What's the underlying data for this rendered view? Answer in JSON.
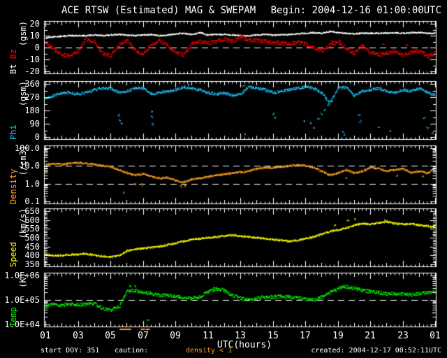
{
  "header": {
    "title": "ACE RTSW (Estimated) MAG & SWEPAM",
    "begin": "Begin: 2004-12-16 01:00:00UTC"
  },
  "footer": {
    "start_doy": "start DOY: 351",
    "caution_label": "caution:",
    "caution_value": "density < 1",
    "created": "created: 2004-12-17 00:52:11UTC"
  },
  "colors": {
    "background": "#000000",
    "frame": "#ffffff",
    "bt": "#ffffff",
    "bz": "#ff0000",
    "phi": "#1fc8ff",
    "density": "#ffa020",
    "speed": "#ffff00",
    "temp": "#00ff00"
  },
  "chart_data": {
    "type": "scatter",
    "title": "ACE RTSW (Estimated) MAG & SWEPAM",
    "x": {
      "label": "UTC(hours)",
      "lim": [
        1,
        25
      ],
      "tick_hours": [
        1,
        3,
        5,
        7,
        9,
        11,
        13,
        15,
        17,
        19,
        21,
        23,
        25
      ],
      "tick_labels": [
        "01",
        "03",
        "05",
        "07",
        "09",
        "11",
        "13",
        "15",
        "17",
        "19",
        "21",
        "23",
        "01"
      ],
      "minor_step_hours": 0.25
    },
    "sample_hours": [
      1,
      1.5,
      2,
      2.5,
      3,
      3.5,
      4,
      4.5,
      5,
      5.5,
      6,
      6.5,
      7,
      7.5,
      8,
      8.5,
      9,
      9.5,
      10,
      10.5,
      11,
      11.5,
      12,
      12.5,
      13,
      13.5,
      14,
      14.5,
      15,
      15.5,
      16,
      16.5,
      17,
      17.5,
      18,
      18.5,
      19,
      19.5,
      20,
      20.5,
      21,
      21.5,
      22,
      22.5,
      23,
      23.5,
      24,
      24.5,
      25
    ],
    "caution_hours": [
      5.7,
      5.95,
      6.15,
      7.0,
      7.3
    ],
    "panels": [
      {
        "id": "mag",
        "ylabel_lines": [
          [
            {
              "text": "Bt ",
              "color": "#ffffff"
            },
            {
              "text": "Bz",
              "color": "#ff0000"
            }
          ],
          [
            {
              "text": "(gsm)",
              "color": "#ffffff"
            }
          ]
        ],
        "scale": "linear",
        "ylim": [
          -20,
          20
        ],
        "yticks": [
          {
            "v": 20,
            "label": "20"
          },
          {
            "v": 10,
            "label": "10"
          },
          {
            "v": 0,
            "label": "0"
          },
          {
            "v": -10,
            "label": "-10"
          },
          {
            "v": -20,
            "label": "-20"
          }
        ],
        "yminor_step": 5,
        "dashed": [
          0
        ],
        "series": [
          {
            "name": "Bt",
            "color": "#ffffff",
            "jitter": 0.5,
            "values": [
              8,
              9,
              9.5,
              10,
              10,
              10,
              10.5,
              10,
              10.5,
              11,
              10.5,
              10,
              10.5,
              11,
              10,
              10.5,
              11.5,
              12,
              11,
              12.5,
              10.5,
              11,
              11,
              10.5,
              10,
              10,
              10.5,
              11,
              10.5,
              10.5,
              11,
              11.5,
              12,
              12.5,
              12,
              13.5,
              12.5,
              12,
              11.5,
              12,
              12,
              12,
              12,
              12.5,
              12,
              12.5,
              12.5,
              12,
              12
            ],
            "outliers": []
          },
          {
            "name": "Bz",
            "color": "#ff0000",
            "jitter": 1.6,
            "values": [
              5,
              -2,
              -6,
              -7,
              -3,
              7,
              5,
              -5,
              -7,
              2,
              6,
              -2,
              -6,
              2,
              6,
              1,
              -4,
              -6,
              3,
              5,
              4,
              5,
              7,
              5,
              9,
              6,
              6,
              5,
              4,
              4,
              3,
              4,
              3,
              0,
              -3,
              2,
              5,
              -1,
              -5,
              2,
              -4,
              -6,
              -5,
              -3,
              -6,
              -4,
              -3,
              -7,
              -5
            ],
            "outliers": [
              [
                13.1,
                10.5
              ],
              [
                18.6,
                6
              ],
              [
                19.1,
                6.5
              ],
              [
                21.8,
                3
              ],
              [
                23.2,
                2
              ],
              [
                24.6,
                -8.5
              ]
            ]
          }
        ]
      },
      {
        "id": "phi",
        "ylabel_lines": [
          [
            {
              "text": "Phi",
              "color": "#1fc8ff"
            }
          ],
          [
            {
              "text": "(gsm)",
              "color": "#ffffff"
            }
          ]
        ],
        "scale": "linear",
        "ylim": [
          0,
          360
        ],
        "yticks": [
          {
            "v": 360,
            "label": "360"
          },
          {
            "v": 270,
            "label": "270"
          },
          {
            "v": 180,
            "label": "180"
          },
          {
            "v": 90,
            "label": "90"
          },
          {
            "v": 0,
            "label": "0"
          }
        ],
        "yminor_step": 45,
        "dashed": [],
        "series": [
          {
            "name": "Phi",
            "color": "#1fc8ff",
            "jitter": 9,
            "values": [
              265,
              280,
              300,
              300,
              290,
              300,
              320,
              330,
              330,
              300,
              310,
              330,
              330,
              290,
              300,
              310,
              320,
              340,
              330,
              320,
              300,
              290,
              300,
              280,
              290,
              340,
              330,
              320,
              300,
              310,
              320,
              330,
              340,
              330,
              300,
              230,
              330,
              340,
              280,
              310,
              320,
              330,
              310,
              300,
              320,
              310,
              330,
              300,
              285
            ],
            "outliers": [
              [
                5.5,
                150
              ],
              [
                5.55,
                120
              ],
              [
                5.65,
                95
              ],
              [
                7.5,
                175
              ],
              [
                7.55,
                140
              ],
              [
                7.6,
                90
              ],
              [
                9.8,
                358
              ],
              [
                13.2,
                355
              ],
              [
                13.25,
                20
              ],
              [
                15.05,
                160
              ],
              [
                15.1,
                130
              ],
              [
                16.9,
                115
              ],
              [
                17.3,
                100
              ],
              [
                17.5,
                65
              ],
              [
                17.8,
                130
              ],
              [
                18.0,
                160
              ],
              [
                18.2,
                190
              ],
              [
                18.4,
                220
              ],
              [
                18.6,
                250
              ],
              [
                19.3,
                40
              ],
              [
                19.35,
                15
              ],
              [
                20.3,
                150
              ],
              [
                20.35,
                110
              ],
              [
                21.5,
                65
              ],
              [
                22.2,
                45
              ],
              [
                24.3,
                130
              ],
              [
                24.5,
                65
              ],
              [
                24.8,
                25
              ]
            ]
          }
        ]
      },
      {
        "id": "density",
        "ylabel_lines": [
          [
            {
              "text": "Density",
              "color": "#ffa020"
            }
          ],
          [
            {
              "text": "(/cm3)",
              "color": "#ffffff"
            }
          ]
        ],
        "scale": "log",
        "ylim": [
          0.1,
          100
        ],
        "yticks": [
          {
            "v": 100,
            "label": "100.0"
          },
          {
            "v": 10,
            "label": "10.0"
          },
          {
            "v": 1,
            "label": "1.0"
          },
          {
            "v": 0.1,
            "label": "0.1"
          }
        ],
        "dashed": [
          10,
          1
        ],
        "series": [
          {
            "name": "Density",
            "color": "#ffa020",
            "jitter": 0.05,
            "values": [
              12,
              13,
              12,
              14,
              15,
              14,
              12,
              10,
              9,
              6,
              4,
              3,
              3.5,
              2.5,
              2,
              2.2,
              1.5,
              1.2,
              1.8,
              2,
              2.5,
              3,
              3.5,
              4,
              4.5,
              5,
              7,
              8,
              8,
              9,
              10,
              11,
              10,
              8,
              5,
              3,
              4,
              6,
              4,
              5,
              8,
              7,
              5,
              6,
              7,
              4,
              5,
              4,
              8
            ],
            "outliers": [
              [
                5.8,
                0.32
              ],
              [
                6.5,
                1.0
              ],
              [
                6.9,
                0.9
              ],
              [
                9.3,
                0.75
              ],
              [
                9.6,
                0.8
              ],
              [
                19.5,
                2.2
              ],
              [
                22.6,
                3
              ],
              [
                24.2,
                3
              ]
            ]
          }
        ]
      },
      {
        "id": "speed",
        "ylabel_lines": [
          [
            {
              "text": "Speed",
              "color": "#ffff00"
            }
          ],
          [
            {
              "text": "(km/s)",
              "color": "#ffffff"
            }
          ]
        ],
        "scale": "linear",
        "ylim": [
          350,
          650
        ],
        "yticks": [
          {
            "v": 650,
            "label": "650"
          },
          {
            "v": 600,
            "label": "600"
          },
          {
            "v": 550,
            "label": "550"
          },
          {
            "v": 500,
            "label": "500"
          },
          {
            "v": 450,
            "label": "450"
          },
          {
            "v": 400,
            "label": "400"
          },
          {
            "v": 350,
            "label": "350"
          }
        ],
        "yminor_step": 10,
        "dashed": [],
        "series": [
          {
            "name": "Speed",
            "color": "#ffff00",
            "jitter": 5,
            "values": [
              405,
              400,
              400,
              405,
              405,
              410,
              400,
              395,
              390,
              400,
              425,
              435,
              440,
              445,
              450,
              460,
              470,
              480,
              490,
              495,
              500,
              505,
              510,
              515,
              510,
              505,
              500,
              495,
              490,
              485,
              480,
              485,
              495,
              505,
              520,
              535,
              545,
              555,
              570,
              580,
              575,
              585,
              590,
              580,
              575,
              580,
              570,
              565,
              560
            ],
            "outliers": [
              [
                18.8,
                575
              ],
              [
                19.6,
                600
              ],
              [
                20.1,
                610
              ],
              [
                21.9,
                600
              ],
              [
                24.9,
                520
              ]
            ]
          }
        ]
      },
      {
        "id": "temp",
        "ylabel_lines": [
          [
            {
              "text": "Temp",
              "color": "#00ff00"
            }
          ],
          [
            {
              "text": "(K)",
              "color": "#ffffff"
            }
          ]
        ],
        "scale": "log",
        "ylim": [
          10000,
          1000000
        ],
        "yticks": [
          {
            "v": 1000000,
            "label": "1.0E+06"
          },
          {
            "v": 100000,
            "label": "1.0E+05"
          },
          {
            "v": 10000,
            "label": "1.0E+04"
          }
        ],
        "dashed": [
          100000
        ],
        "series": [
          {
            "name": "Temp",
            "color": "#00ff00",
            "jitter": 0.07,
            "values": [
              60000,
              65000,
              60000,
              70000,
              65000,
              65000,
              70000,
              45000,
              40000,
              50000,
              220000,
              250000,
              200000,
              180000,
              150000,
              160000,
              140000,
              130000,
              120000,
              130000,
              220000,
              280000,
              250000,
              150000,
              120000,
              100000,
              120000,
              130000,
              130000,
              140000,
              130000,
              120000,
              110000,
              100000,
              130000,
              200000,
              300000,
              350000,
              300000,
              250000,
              220000,
              200000,
              180000,
              180000,
              170000,
              160000,
              180000,
              200000,
              220000
            ],
            "outliers": [
              [
                6.2,
                400000
              ],
              [
                6.5,
                380000
              ],
              [
                11.4,
                330000
              ],
              [
                7.3,
                16000
              ],
              [
                24.85,
                32000
              ]
            ]
          }
        ]
      }
    ]
  }
}
